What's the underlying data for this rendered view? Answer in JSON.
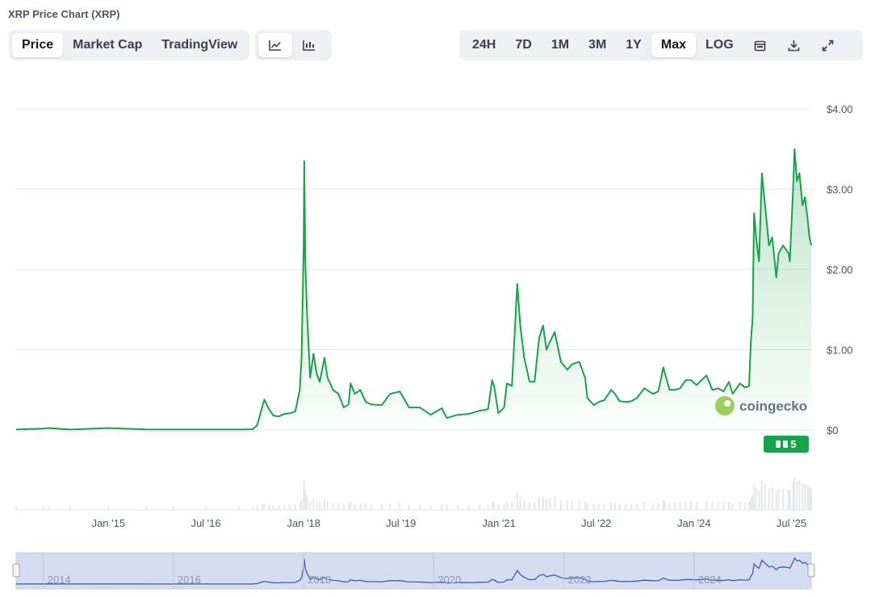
{
  "title": "XRP Price Chart (XRP)",
  "tabs": [
    {
      "label": "Price",
      "active": true
    },
    {
      "label": "Market Cap",
      "active": false
    },
    {
      "label": "TradingView",
      "active": false
    }
  ],
  "chart_type_icons": [
    "line-chart-icon",
    "candlestick-chart-icon"
  ],
  "ranges": [
    {
      "label": "24H",
      "active": false
    },
    {
      "label": "7D",
      "active": false
    },
    {
      "label": "1M",
      "active": false
    },
    {
      "label": "3M",
      "active": false
    },
    {
      "label": "1Y",
      "active": false
    },
    {
      "label": "Max",
      "active": true
    },
    {
      "label": "LOG",
      "active": false
    }
  ],
  "toolbar_icons": [
    "calendar-icon",
    "download-icon",
    "expand-icon"
  ],
  "watermark": "coingecko",
  "badge": "5",
  "colors": {
    "line": "#16a34a",
    "navigator_line": "#3b5ba9",
    "navigator_bg": "#d6dcf0",
    "volume": "#e5e7eb"
  },
  "chart_data": {
    "type": "area",
    "title": "",
    "xlabel": "",
    "ylabel": "",
    "ylim": [
      0,
      4
    ],
    "xlim": [
      "2013-08-01",
      "2025-10-20"
    ],
    "y_ticks": [
      0,
      1,
      2,
      3,
      4
    ],
    "y_tick_labels": [
      "$0",
      "$1.00",
      "$2.00",
      "$3.00",
      "$4.00"
    ],
    "x_ticks": [
      "2015-01-01",
      "2016-07-01",
      "2018-01-01",
      "2019-07-01",
      "2021-01-01",
      "2022-07-01",
      "2024-01-01",
      "2025-07-01"
    ],
    "x_tick_labels": [
      "Jan '15",
      "Jul '16",
      "Jan '18",
      "Jul '19",
      "Jan '21",
      "Jul '22",
      "Jan '24",
      "Jul '25"
    ],
    "grid": true,
    "log_scale": false,
    "series": [
      {
        "x": [
          "2013-08-01",
          "2014-01-01",
          "2014-02-01",
          "2014-06-01",
          "2015-01-01",
          "2015-08-01",
          "2016-01-01",
          "2016-07-01",
          "2017-01-01",
          "2017-03-20",
          "2017-04-15",
          "2017-05-15",
          "2017-05-25",
          "2017-06-20",
          "2017-07-15",
          "2017-08-15",
          "2017-09-15",
          "2017-10-15",
          "2017-11-15",
          "2017-12-10",
          "2017-12-20",
          "2018-01-01",
          "2018-01-04",
          "2018-01-10",
          "2018-01-20",
          "2018-02-06",
          "2018-02-25",
          "2018-03-15",
          "2018-04-01",
          "2018-04-28",
          "2018-05-15",
          "2018-06-15",
          "2018-07-15",
          "2018-08-14",
          "2018-09-10",
          "2018-09-21",
          "2018-10-15",
          "2018-11-15",
          "2018-12-15",
          "2019-01-15",
          "2019-03-15",
          "2019-05-01",
          "2019-06-25",
          "2019-08-15",
          "2019-10-15",
          "2019-12-15",
          "2020-02-15",
          "2020-03-15",
          "2020-05-15",
          "2020-07-15",
          "2020-09-15",
          "2020-11-01",
          "2020-11-24",
          "2020-12-05",
          "2020-12-29",
          "2021-01-30",
          "2021-02-15",
          "2021-03-15",
          "2021-04-14",
          "2021-05-01",
          "2021-05-23",
          "2021-06-22",
          "2021-07-20",
          "2021-08-15",
          "2021-09-06",
          "2021-09-25",
          "2021-10-15",
          "2021-11-10",
          "2021-12-15",
          "2022-01-20",
          "2022-02-15",
          "2022-03-28",
          "2022-04-30",
          "2022-05-12",
          "2022-06-18",
          "2022-07-15",
          "2022-08-15",
          "2022-09-23",
          "2022-10-15",
          "2022-11-09",
          "2022-12-15",
          "2023-01-15",
          "2023-02-15",
          "2023-03-28",
          "2023-05-15",
          "2023-06-15",
          "2023-07-13",
          "2023-07-20",
          "2023-08-17",
          "2023-09-15",
          "2023-10-15",
          "2023-11-15",
          "2023-12-15",
          "2024-01-15",
          "2024-03-11",
          "2024-04-13",
          "2024-05-15",
          "2024-06-15",
          "2024-07-15",
          "2024-08-05",
          "2024-09-15",
          "2024-10-15",
          "2024-11-05",
          "2024-11-15",
          "2024-11-25",
          "2024-12-03",
          "2024-12-15",
          "2024-12-31",
          "2025-01-16",
          "2025-02-03",
          "2025-02-25",
          "2025-03-15",
          "2025-04-07",
          "2025-04-20",
          "2025-05-15",
          "2025-06-15",
          "2025-06-22",
          "2025-07-10",
          "2025-07-18",
          "2025-08-01",
          "2025-08-15",
          "2025-09-01",
          "2025-09-15",
          "2025-10-01",
          "2025-10-10",
          "2025-10-20"
        ],
        "y": [
          0.006,
          0.018,
          0.024,
          0.006,
          0.024,
          0.008,
          0.006,
          0.006,
          0.006,
          0.009,
          0.06,
          0.3,
          0.38,
          0.26,
          0.18,
          0.17,
          0.2,
          0.21,
          0.23,
          0.5,
          0.9,
          2.3,
          3.35,
          2.1,
          1.45,
          0.65,
          0.95,
          0.7,
          0.6,
          0.9,
          0.65,
          0.5,
          0.45,
          0.28,
          0.32,
          0.58,
          0.45,
          0.5,
          0.35,
          0.32,
          0.31,
          0.45,
          0.48,
          0.28,
          0.28,
          0.19,
          0.27,
          0.15,
          0.19,
          0.2,
          0.24,
          0.26,
          0.62,
          0.55,
          0.21,
          0.28,
          0.58,
          0.55,
          1.82,
          1.3,
          0.9,
          0.6,
          0.6,
          1.15,
          1.3,
          1.0,
          1.1,
          1.22,
          0.85,
          0.75,
          0.82,
          0.85,
          0.65,
          0.4,
          0.31,
          0.35,
          0.37,
          0.5,
          0.45,
          0.36,
          0.35,
          0.36,
          0.4,
          0.52,
          0.45,
          0.48,
          0.78,
          0.72,
          0.5,
          0.5,
          0.52,
          0.62,
          0.62,
          0.56,
          0.68,
          0.5,
          0.52,
          0.48,
          0.6,
          0.45,
          0.58,
          0.53,
          0.55,
          1.1,
          1.4,
          2.7,
          2.4,
          2.1,
          3.2,
          2.8,
          2.3,
          2.4,
          1.9,
          2.2,
          2.3,
          2.2,
          2.1,
          3.0,
          3.5,
          3.1,
          3.2,
          2.8,
          2.9,
          2.6,
          2.4,
          2.3
        ],
        "volume_note": "volume bars shown beneath price"
      }
    ],
    "navigator": {
      "x_tick_labels": [
        "2014",
        "2016",
        "2018",
        "2020",
        "2022",
        "2024"
      ]
    }
  }
}
